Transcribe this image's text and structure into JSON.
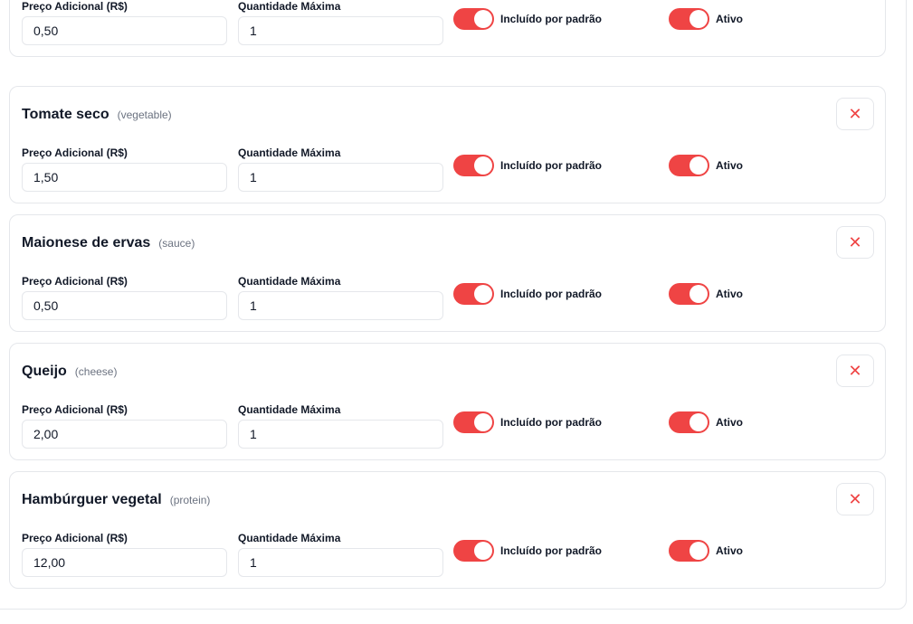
{
  "labels": {
    "price": "Preço Adicional (R$)",
    "quantity": "Quantidade Máxima",
    "default_included": "Incluído por padrão",
    "active": "Ativo"
  },
  "items": [
    {
      "name": "",
      "type": "",
      "price": "0,50",
      "max_qty": "1",
      "default_included": true,
      "active": true
    },
    {
      "name": "Tomate seco",
      "type": "(vegetable)",
      "price": "1,50",
      "max_qty": "1",
      "default_included": true,
      "active": true
    },
    {
      "name": "Maionese de ervas",
      "type": "(sauce)",
      "price": "0,50",
      "max_qty": "1",
      "default_included": true,
      "active": true
    },
    {
      "name": "Queijo",
      "type": "(cheese)",
      "price": "2,00",
      "max_qty": "1",
      "default_included": true,
      "active": true
    },
    {
      "name": "Hambúrguer vegetal",
      "type": "(protein)",
      "price": "12,00",
      "max_qty": "1",
      "default_included": true,
      "active": true
    }
  ],
  "colors": {
    "accent": "#ef4444",
    "border": "#e5e7eb"
  },
  "icons": {
    "remove": "close-icon"
  }
}
